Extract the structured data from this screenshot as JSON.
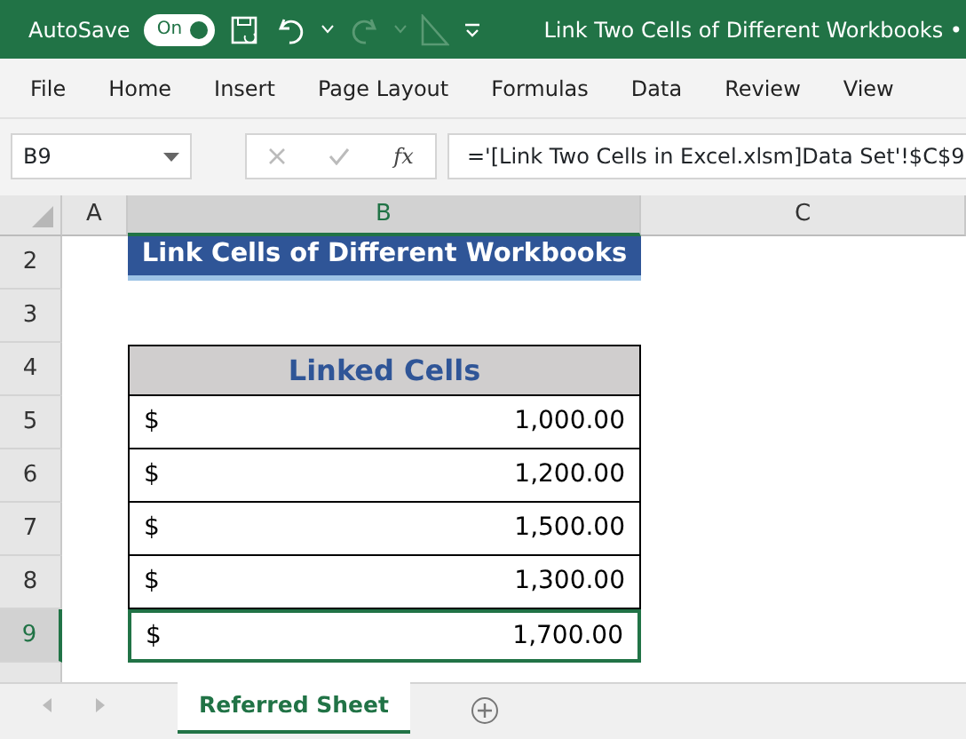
{
  "title_bar": {
    "autosave_label": "AutoSave",
    "autosave_on": true,
    "toggle_text": "On",
    "title": "Link Two Cells of Different Workbooks •"
  },
  "ribbon_tabs": [
    {
      "label": "File"
    },
    {
      "label": "Home"
    },
    {
      "label": "Insert"
    },
    {
      "label": "Page Layout"
    },
    {
      "label": "Formulas"
    },
    {
      "label": "Data"
    },
    {
      "label": "Review"
    },
    {
      "label": "View"
    }
  ],
  "formula_bar": {
    "name_box": "B9",
    "fx": "fx",
    "formula": "='[Link Two Cells in Excel.xlsm]Data Set'!$C$9"
  },
  "columns": [
    {
      "label": "A",
      "selected": false
    },
    {
      "label": "B",
      "selected": true
    },
    {
      "label": "C",
      "selected": false
    }
  ],
  "rows": [
    {
      "number": "2",
      "selected": false,
      "kind": "title",
      "text": "Link Cells of Different Workbooks"
    },
    {
      "number": "3",
      "selected": false,
      "kind": "blank"
    },
    {
      "number": "4",
      "selected": false,
      "kind": "header",
      "text": "Linked Cells"
    },
    {
      "number": "5",
      "selected": false,
      "kind": "value",
      "currency": "$",
      "amount": "1,000.00"
    },
    {
      "number": "6",
      "selected": false,
      "kind": "value",
      "currency": "$",
      "amount": "1,200.00"
    },
    {
      "number": "7",
      "selected": false,
      "kind": "value",
      "currency": "$",
      "amount": "1,500.00"
    },
    {
      "number": "8",
      "selected": false,
      "kind": "value",
      "currency": "$",
      "amount": "1,300.00"
    },
    {
      "number": "9",
      "selected": true,
      "kind": "value",
      "currency": "$",
      "amount": "1,700.00"
    }
  ],
  "sheet_tabs": [
    {
      "label": "Referred Sheet",
      "selected": true
    }
  ]
}
